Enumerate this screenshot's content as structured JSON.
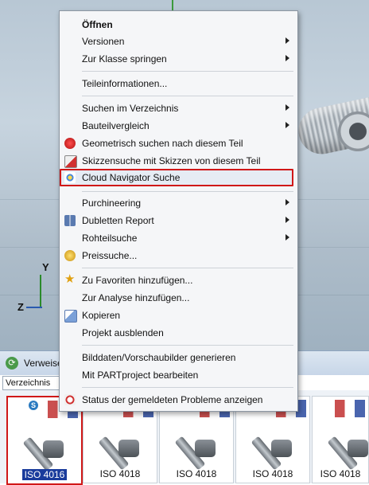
{
  "menu": {
    "items": [
      {
        "label": "Öffnen",
        "submenu": false
      },
      {
        "label": "Versionen",
        "submenu": true
      },
      {
        "label": "Zur Klasse springen",
        "submenu": true
      },
      {
        "label": "Teileinformationen...",
        "submenu": false
      },
      {
        "label": "Suchen im Verzeichnis",
        "submenu": true
      },
      {
        "label": "Bauteilvergleich",
        "submenu": true
      },
      {
        "label": "Geometrisch suchen nach diesem Teil",
        "submenu": false
      },
      {
        "label": "Skizzensuche mit Skizzen von diesem Teil",
        "submenu": false
      },
      {
        "label": "Cloud Navigator Suche",
        "submenu": false
      },
      {
        "label": "Purchineering",
        "submenu": true
      },
      {
        "label": "Dubletten Report",
        "submenu": true
      },
      {
        "label": "Rohteilsuche",
        "submenu": true
      },
      {
        "label": "Preissuche...",
        "submenu": false
      },
      {
        "label": "Zu Favoriten hinzufügen...",
        "submenu": false
      },
      {
        "label": "Zur Analyse hinzufügen...",
        "submenu": false
      },
      {
        "label": "Kopieren",
        "submenu": false
      },
      {
        "label": "Projekt ausblenden",
        "submenu": false
      },
      {
        "label": "Bilddaten/Vorschaubilder generieren",
        "submenu": false
      },
      {
        "label": "Mit PARTproject bearbeiten",
        "submenu": false
      },
      {
        "label": "Status der gemeldeten Probleme anzeigen",
        "submenu": false
      }
    ]
  },
  "viewport": {
    "axis_y": "Y",
    "axis_z": "Z"
  },
  "panel": {
    "title": "Verweise",
    "directory_field": "Verzeichnis"
  },
  "thumbnails": [
    {
      "label": "ISO 4016",
      "selected": true
    },
    {
      "label": "ISO 4018",
      "selected": false
    },
    {
      "label": "ISO 4018",
      "selected": false
    },
    {
      "label": "ISO 4018",
      "selected": false
    },
    {
      "label": "ISO 4018",
      "selected": false
    }
  ],
  "colors": {
    "highlight_border": "#d01818",
    "selection_fill": "#1a3c9c"
  }
}
